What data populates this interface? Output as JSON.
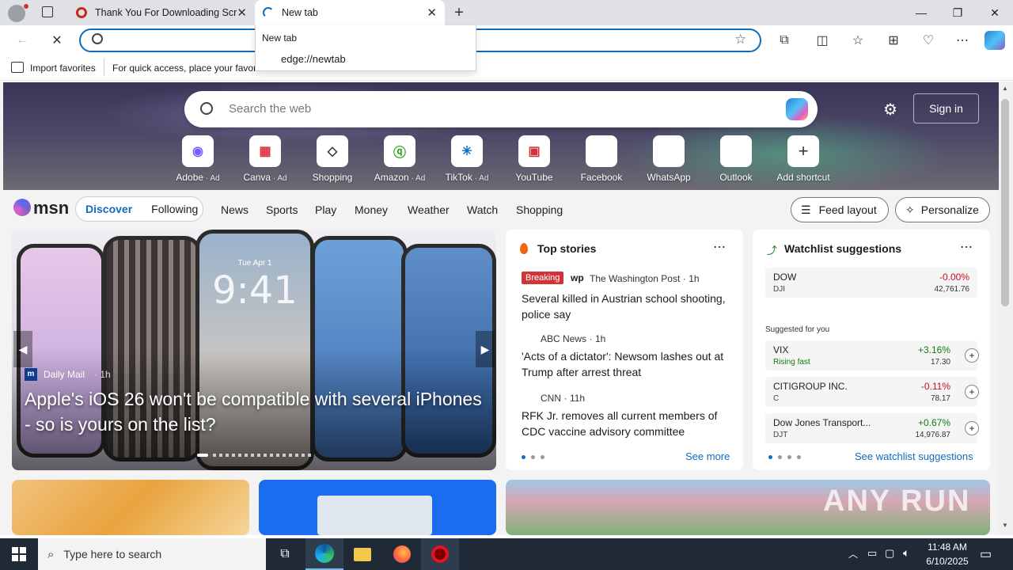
{
  "tabs": [
    {
      "title": "Thank You For Downloading Scre"
    },
    {
      "title": "New tab"
    }
  ],
  "address": {
    "value": ""
  },
  "dropdown": {
    "heading": "New tab",
    "url": "edge://newtab"
  },
  "favorites_bar": {
    "import_label": "Import favorites",
    "hint": "For quick access, place your favori"
  },
  "hero": {
    "search_placeholder": "Search the web",
    "signin_label": "Sign in",
    "shortcuts": [
      {
        "label": "Adobe",
        "ad": " · Ad"
      },
      {
        "label": "Canva",
        "ad": " · Ad"
      },
      {
        "label": "Shopping",
        "ad": ""
      },
      {
        "label": "Amazon",
        "ad": " · Ad"
      },
      {
        "label": "TikTok",
        "ad": " · Ad"
      },
      {
        "label": "YouTube",
        "ad": ""
      },
      {
        "label": "Facebook",
        "ad": ""
      },
      {
        "label": "WhatsApp",
        "ad": ""
      },
      {
        "label": "Outlook",
        "ad": ""
      },
      {
        "label": "Add shortcut",
        "ad": ""
      }
    ]
  },
  "msn": {
    "logo": "msn",
    "discover": "Discover",
    "following": "Following",
    "nav": [
      "News",
      "Sports",
      "Play",
      "Money",
      "Weather",
      "Watch",
      "Shopping"
    ],
    "feed_layout": "Feed layout",
    "personalize": "Personalize"
  },
  "main_card": {
    "source": "Daily Mail",
    "age": "· 1h",
    "headline": "Apple's iOS 26 won't be compatible with several iPhones - so is yours on the list?",
    "phone_time": "9:41",
    "phone_date": "Tue Apr 1"
  },
  "top_stories": {
    "title": "Top stories",
    "see_more": "See more",
    "items": [
      {
        "badge": "Breaking",
        "source": "The Washington Post",
        "age": "· 1h",
        "headline": "Several killed in Austrian school shooting, police say"
      },
      {
        "badge": "",
        "source": "ABC News",
        "age": "· 1h",
        "headline": "'Acts of a dictator': Newsom lashes out at Trump after arrest threat"
      },
      {
        "badge": "",
        "source": "CNN",
        "age": "· 11h",
        "headline": "RFK Jr. removes all current members of CDC vaccine advisory committee"
      }
    ]
  },
  "watchlist": {
    "title": "Watchlist suggestions",
    "suggested_label": "Suggested for you",
    "see_all": "See watchlist suggestions",
    "stocks": [
      {
        "name": "DOW",
        "symbol": "DJI",
        "change": "-0.00%",
        "price": "42,761.76",
        "direction": "down"
      },
      {
        "name": "VIX",
        "symbol": "Rising fast",
        "change": "+3.16%",
        "price": "17.30",
        "direction": "up"
      },
      {
        "name": "CITIGROUP INC.",
        "symbol": "C",
        "change": "-0.11%",
        "price": "78.17",
        "direction": "down"
      },
      {
        "name": "Dow Jones Transport...",
        "symbol": "DJT",
        "change": "+0.67%",
        "price": "14,976.87",
        "direction": "up"
      }
    ]
  },
  "taskbar": {
    "search_placeholder": "Type here to search",
    "time": "11:48 AM",
    "date": "6/10/2025"
  },
  "watermark": "ANY RUN",
  "colors": {
    "accent": "#0f6cbd",
    "up": "#107c10",
    "down": "#c50f1f",
    "breaking": "#d13438"
  }
}
